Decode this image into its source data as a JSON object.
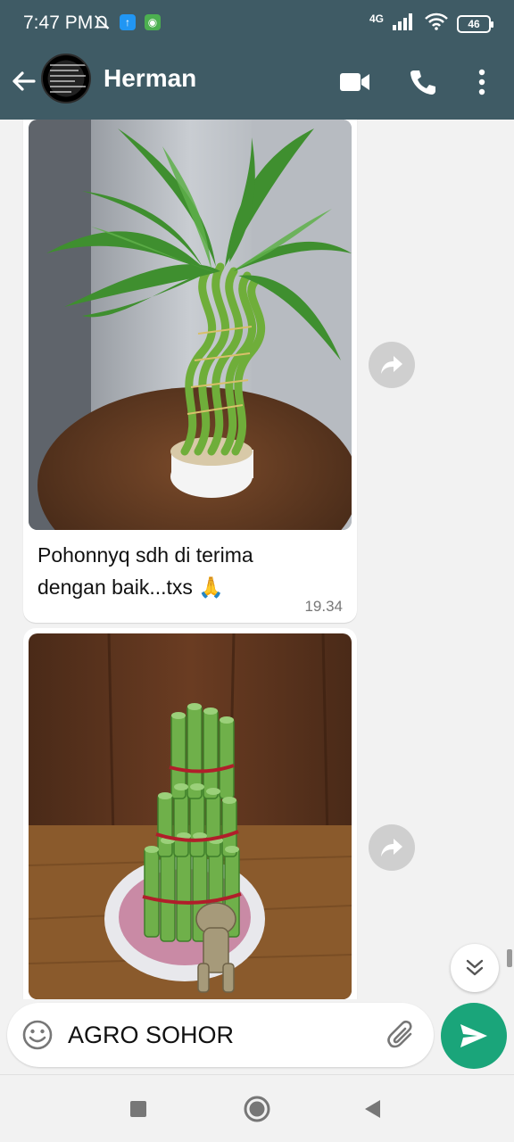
{
  "status_bar": {
    "time": "7:47 PM",
    "network": "4G",
    "battery": "46",
    "icons": [
      "mute-icon",
      "upload-badge-icon",
      "android-badge-icon",
      "signal-icon",
      "wifi-icon",
      "battery-icon"
    ]
  },
  "header": {
    "contact_name": "Herman",
    "icons": [
      "back-arrow-icon",
      "video-call-icon",
      "voice-call-icon",
      "more-vert-icon"
    ]
  },
  "messages": [
    {
      "type": "image",
      "image_subject": "lucky-bamboo-twisted-plant",
      "caption": "Pohonnyq sdh di terima dengan baik...txs 🙏",
      "time": "19.34"
    },
    {
      "type": "image",
      "image_subject": "lucky-bamboo-tower-plant",
      "caption": "",
      "time": ""
    }
  ],
  "composer": {
    "text": "AGRO SOHOR",
    "icons": [
      "emoji-icon",
      "attach-icon",
      "send-icon"
    ]
  },
  "navigation": {
    "icons": [
      "recents-square-icon",
      "home-circle-icon",
      "back-triangle-icon"
    ]
  },
  "colors": {
    "header": "#3f5b65",
    "chat_background": "#f2f2f2",
    "send_button": "#1aa57a",
    "bubble": "#ffffff"
  }
}
